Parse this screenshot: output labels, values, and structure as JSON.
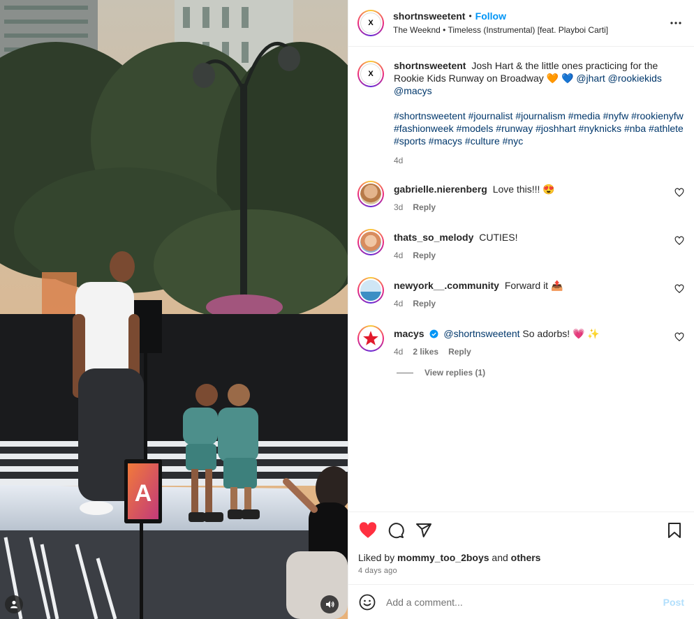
{
  "post": {
    "author": "shortnsweetent",
    "follow_label": "Follow",
    "separator": "•",
    "audio": "The Weeknd • Timeless (Instrumental) [feat. Playboi Carti]",
    "more_icon": "more-horizontal-icon",
    "logo_letter": "X"
  },
  "caption": {
    "author": "shortnsweetent",
    "text": "Josh Hart & the little ones practicing for the Rookie Kids Runway on Broadway 🧡 💙",
    "mentions": [
      "@jhart",
      "@rookiekids",
      "@macys"
    ],
    "hashtags": "#shortnsweetent #journalist #journalism #media #nyfw #rookienyfw #fashionweek #models #runway #joshhart #nyknicks #nba #athlete #sports #macys #culture #nyc",
    "time": "4d"
  },
  "comments": [
    {
      "user": "gabrielle.nierenberg",
      "text": "Love this!!! 😍",
      "time": "3d",
      "likes": "",
      "reply": "Reply"
    },
    {
      "user": "thats_so_melody",
      "text": "CUTIES!",
      "time": "4d",
      "likes": "",
      "reply": "Reply"
    },
    {
      "user": "newyork__.community",
      "text": "Forward it 📤",
      "time": "4d",
      "likes": "",
      "reply": "Reply"
    },
    {
      "user": "macys",
      "mention": "@shortnsweetent",
      "text": "So adorbs! 💗 ✨",
      "time": "4d",
      "likes": "2 likes",
      "reply": "Reply",
      "verified": true
    }
  ],
  "view_replies": "View replies (1)",
  "actions": {
    "like_icon": "heart-filled-icon",
    "comment_icon": "comment-icon",
    "share_icon": "share-icon",
    "save_icon": "bookmark-icon",
    "liked_prefix": "Liked by",
    "liked_user": "mommy_too_2boys",
    "liked_and": "and",
    "liked_others": "others",
    "time_ago": "4 days ago",
    "like_color": "#ff3040"
  },
  "add_comment": {
    "placeholder": "Add a comment...",
    "post_label": "Post"
  },
  "media": {
    "sign_letter": "A",
    "user_icon": "user-tag-icon",
    "sound_icon": "speaker-icon"
  }
}
